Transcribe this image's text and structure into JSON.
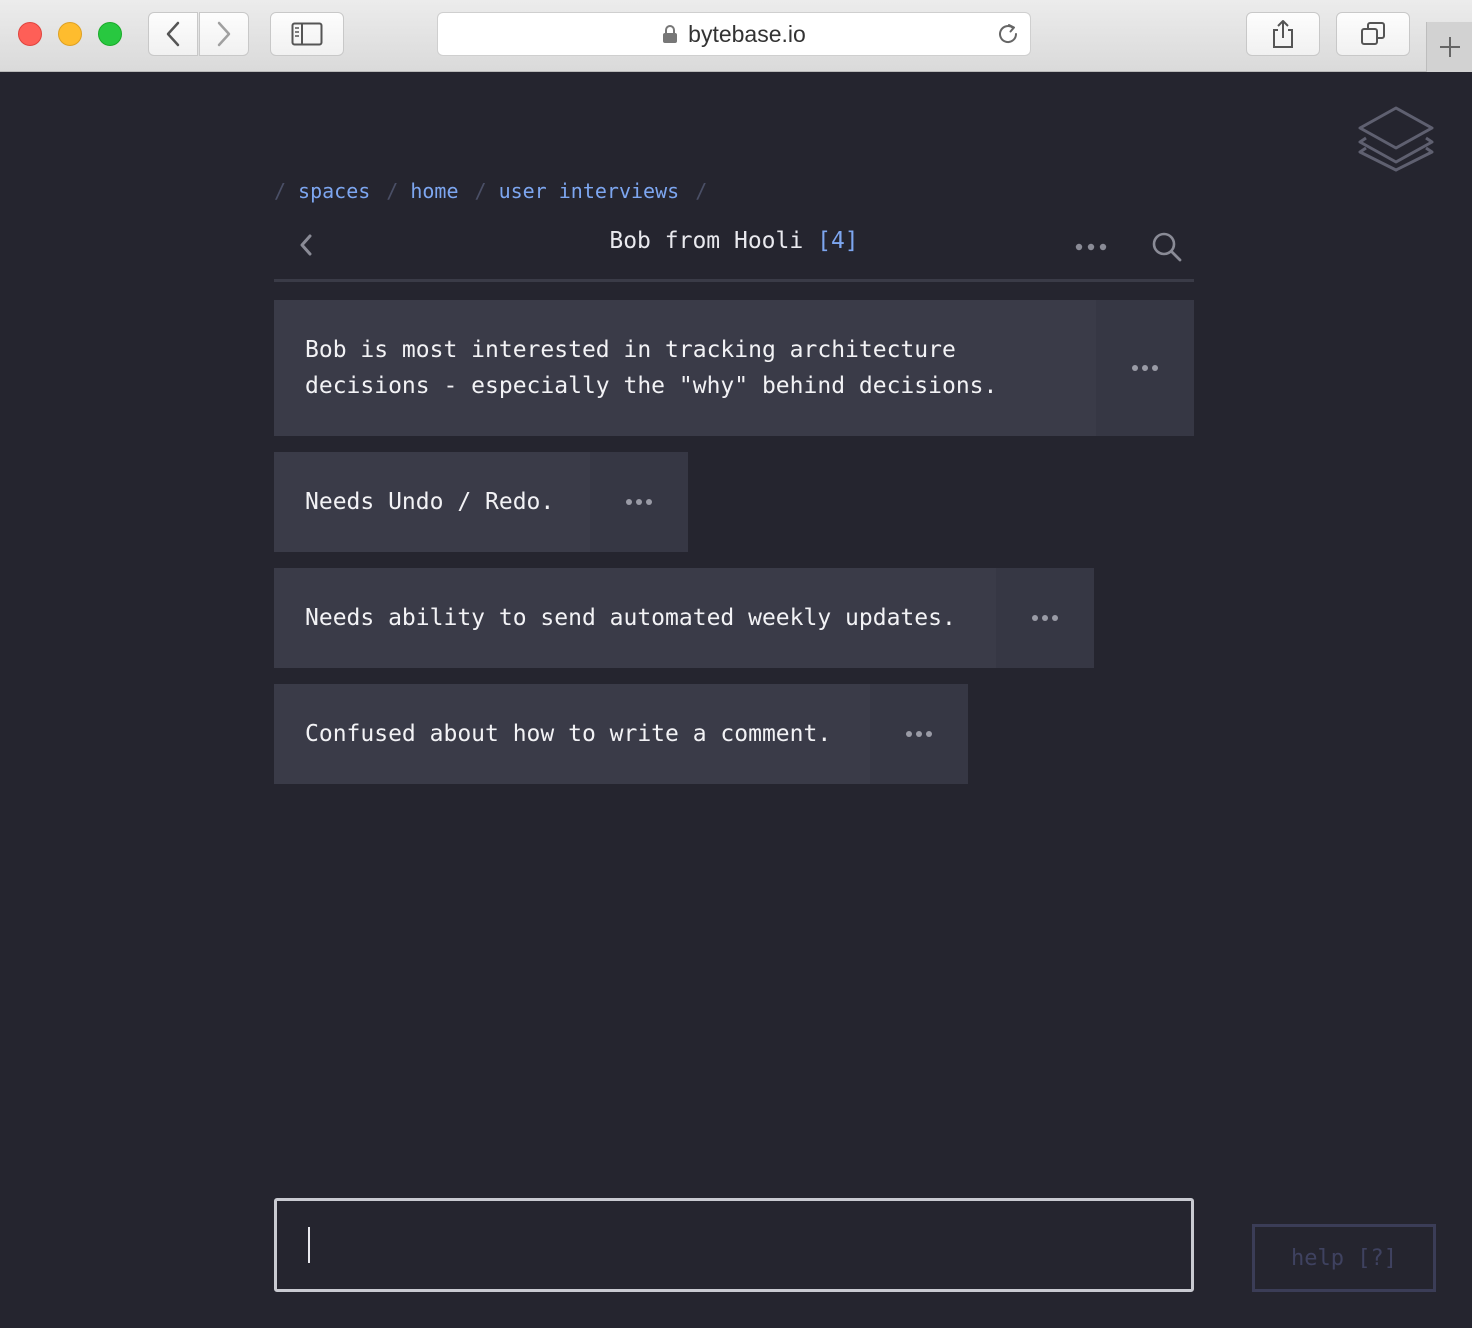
{
  "browser": {
    "url": "bytebase.io"
  },
  "breadcrumb": {
    "separator": "/",
    "items": [
      "spaces",
      "home",
      "user interviews"
    ]
  },
  "header": {
    "title": "Bob from Hooli",
    "count": "[4]"
  },
  "cards": [
    {
      "text": "Bob is most interested in tracking architecture\ndecisions - especially the \"why\" behind decisions."
    },
    {
      "text": "Needs Undo / Redo."
    },
    {
      "text": "Needs ability to send automated weekly updates."
    },
    {
      "text": "Confused about how to write a comment."
    }
  ],
  "composer": {
    "value": "",
    "placeholder": ""
  },
  "help": {
    "label": "help [?]"
  },
  "colors": {
    "background": "#25252f",
    "card": "#3a3b48",
    "accent": "#7da6f0",
    "text": "#f2f2f5"
  }
}
